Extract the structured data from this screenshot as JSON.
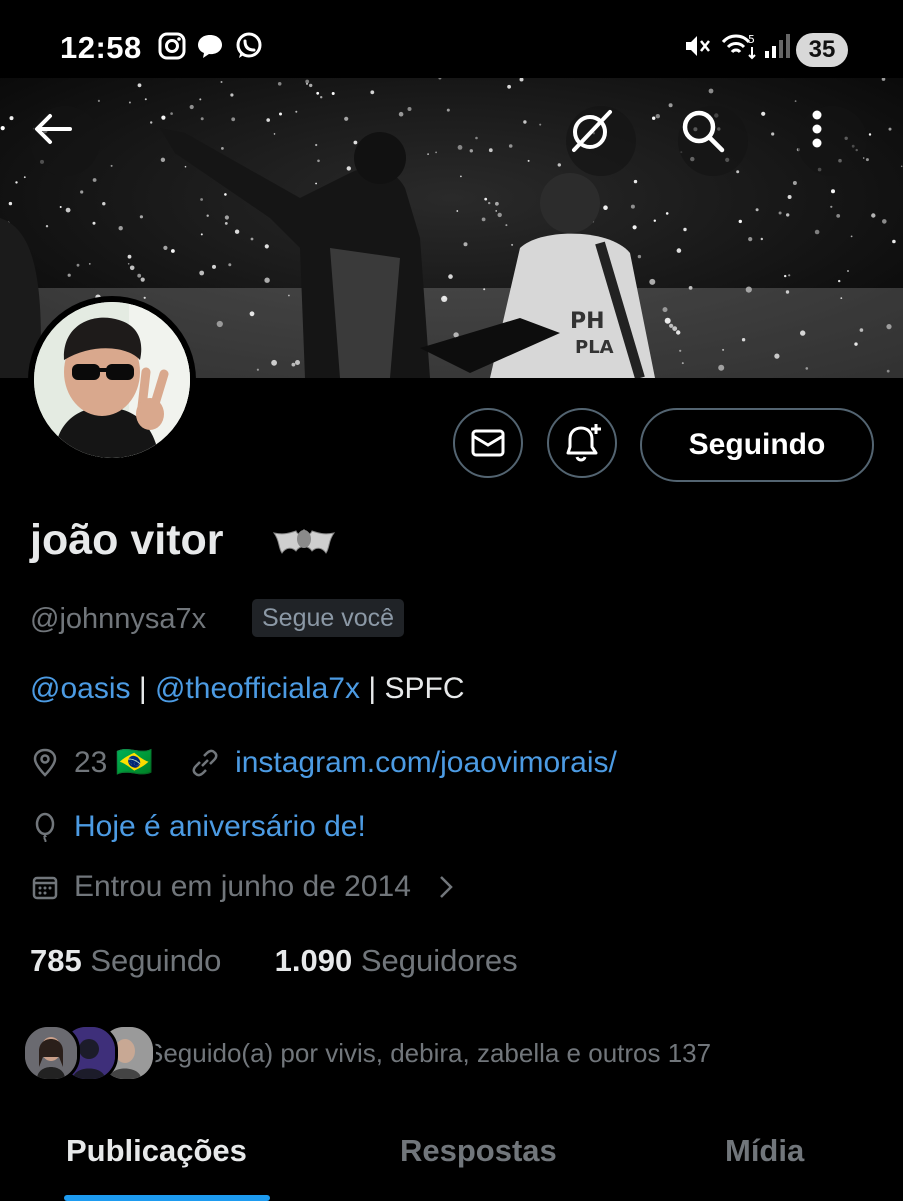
{
  "status_bar": {
    "time": "12:58",
    "notification_icons": [
      "instagram-icon",
      "chat-bubble-icon",
      "whatsapp-icon"
    ],
    "system_icons": [
      "mute-icon",
      "wifi-icon",
      "signal-icon"
    ],
    "battery": "35"
  },
  "header": {
    "back_icon": "back-arrow-icon",
    "grok_icon": "grok-icon",
    "search_icon": "search-icon",
    "more_icon": "more-vertical-icon"
  },
  "profile": {
    "name": "joão vitor",
    "name_emoji": "🦇",
    "handle": "@johnnysa7x",
    "follows_you": "Segue você",
    "bio": {
      "mention1": "@oasis",
      "separator1": " | ",
      "mention2": "@theofficiala7x",
      "separator2": " | ",
      "text": "SPFC"
    },
    "location": "23 🇧🇷",
    "website": "instagram.com/joaovimorais/",
    "birthday": "Hoje é aniversário de!",
    "joined": "Entrou em junho de 2014"
  },
  "actions": {
    "message_icon": "envelope-icon",
    "notify_icon": "bell-plus-icon",
    "follow_label": "Seguindo"
  },
  "stats": {
    "following_count": "785",
    "following_label": "Seguindo",
    "followers_count": "1.090",
    "followers_label": "Seguidores"
  },
  "followed_by": "Seguido(a) por vivis, debira, zabella e outros 137",
  "tabs": [
    {
      "label": "Publicações",
      "active": true
    },
    {
      "label": "Respostas",
      "active": false
    },
    {
      "label": "Mídia",
      "active": false
    }
  ],
  "colors": {
    "background": "#000000",
    "link": "#4c9be3",
    "accent": "#1d9bf0",
    "muted": "#71767b"
  }
}
